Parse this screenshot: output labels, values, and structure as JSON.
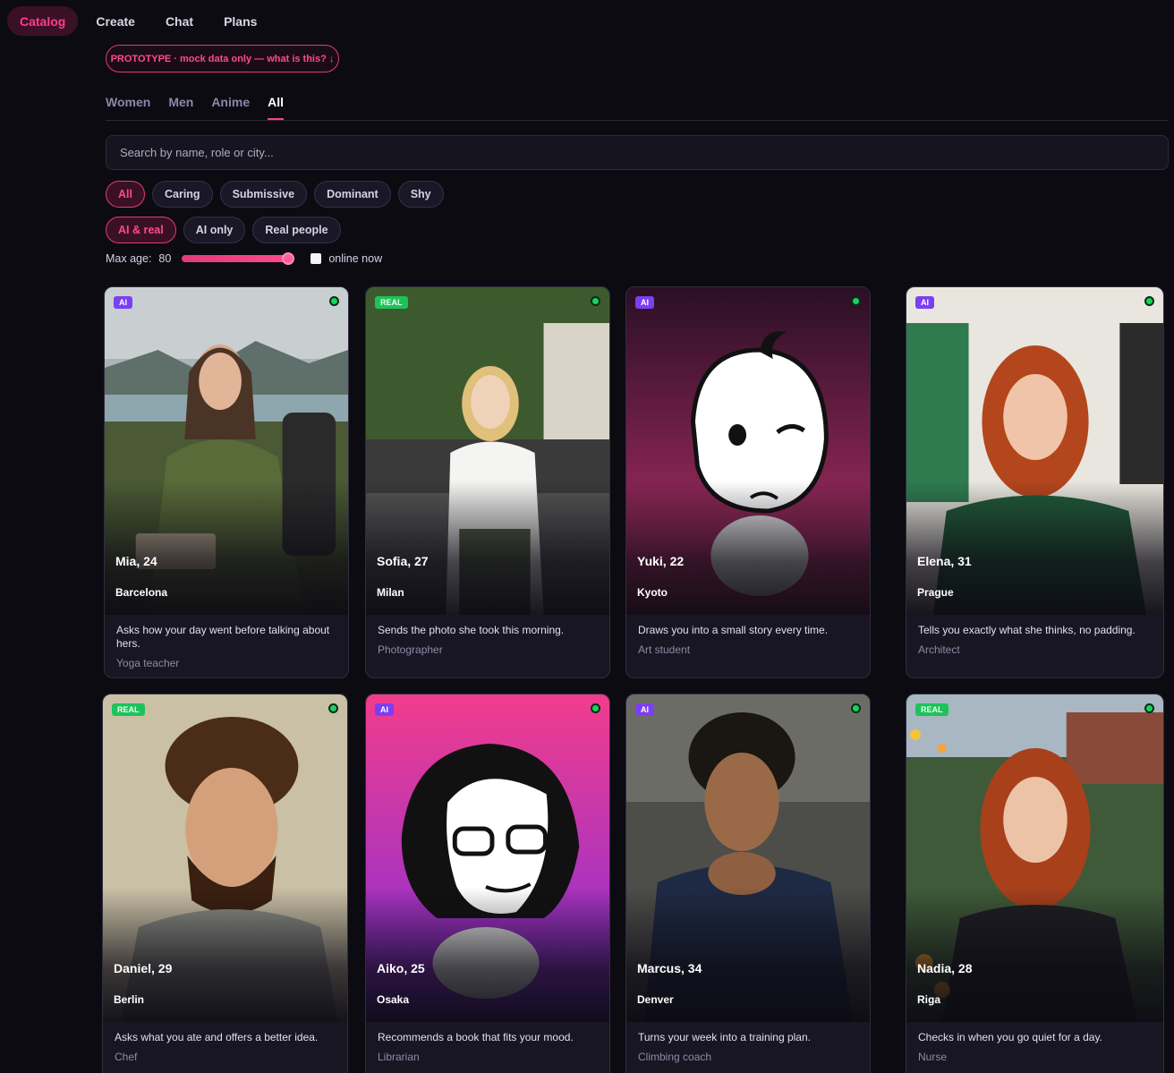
{
  "nav": {
    "items": [
      {
        "label": "Catalog",
        "active": true
      },
      {
        "label": "Create",
        "active": false
      },
      {
        "label": "Chat",
        "active": false
      },
      {
        "label": "Plans",
        "active": false
      }
    ]
  },
  "banner": {
    "label": "PROTOTYPE · mock data only — what is this? ↓"
  },
  "tabs": [
    {
      "label": "Women",
      "active": false
    },
    {
      "label": "Men",
      "active": false
    },
    {
      "label": "Anime",
      "active": false
    },
    {
      "label": "All",
      "active": true
    }
  ],
  "search": {
    "placeholder": "Search by name, role or city..."
  },
  "mood_filters": [
    {
      "label": "All",
      "active": true
    },
    {
      "label": "Caring",
      "active": false
    },
    {
      "label": "Submissive",
      "active": false
    },
    {
      "label": "Dominant",
      "active": false
    },
    {
      "label": "Shy",
      "active": false
    }
  ],
  "type_filters": [
    {
      "label": "AI & real",
      "active": true
    },
    {
      "label": "AI only",
      "active": false
    },
    {
      "label": "Real people",
      "active": false
    }
  ],
  "age": {
    "label": "Max age:",
    "value": "80",
    "slider_fraction": 1.0
  },
  "online_filter": {
    "label": "online now",
    "checked": false
  },
  "cards": [
    {
      "badge": "AI",
      "name": "Mia, 24",
      "city": "Barcelona",
      "desc": "Asks how your day went before talking about hers.",
      "role": "Yoga teacher",
      "online": true
    },
    {
      "badge": "REAL",
      "name": "Sofia, 27",
      "city": "Milan",
      "desc": "Sends the photo she took this morning.",
      "role": "Photographer",
      "online": true
    },
    {
      "badge": "AI",
      "name": "Yuki, 22",
      "city": "Kyoto",
      "desc": "Draws you into a small story every time.",
      "role": "Art student",
      "online": true
    },
    {
      "badge": "AI",
      "name": "Elena, 31",
      "city": "Prague",
      "desc": "Tells you exactly what she thinks, no padding.",
      "role": "Architect",
      "online": true
    },
    {
      "badge": "REAL",
      "name": "Daniel, 29",
      "city": "Berlin",
      "desc": "Asks what you ate and offers a better idea.",
      "role": "Chef",
      "online": true
    },
    {
      "badge": "AI",
      "name": "Aiko, 25",
      "city": "Osaka",
      "desc": "Recommends a book that fits your mood.",
      "role": "Librarian",
      "online": true
    },
    {
      "badge": "AI",
      "name": "Marcus, 34",
      "city": "Denver",
      "desc": "Turns your week into a training plan.",
      "role": "Climbing coach",
      "online": true
    },
    {
      "badge": "REAL",
      "name": "Nadia, 28",
      "city": "Riga",
      "desc": "Checks in when you go quiet for a day.",
      "role": "Nurse",
      "online": true
    }
  ]
}
